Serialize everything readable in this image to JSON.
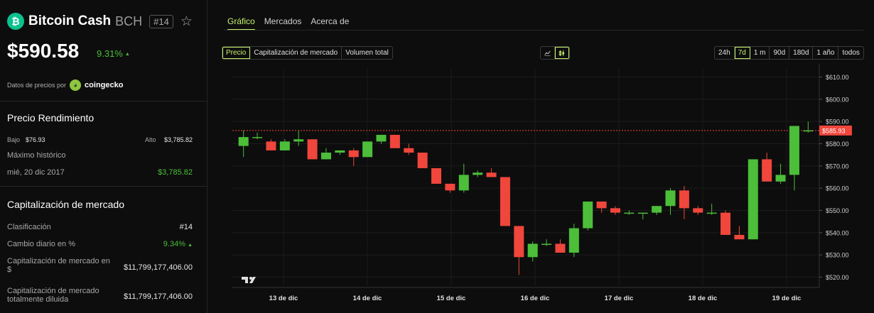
{
  "coin": {
    "logo_glyph": "₿",
    "name": "Bitcoin Cash",
    "symbol": "BCH",
    "rank_badge": "#14",
    "price": "$590.58",
    "change": "9.31%",
    "change_arrow": "▲",
    "data_by_label": "Datos de precios por",
    "data_provider": "coingecko"
  },
  "performance": {
    "title": "Precio Rendimiento",
    "low_label": "Bajo",
    "low_value": "$76.93",
    "high_label": "Alto",
    "high_value": "$3,785.82",
    "ath_label": "Máximo histórico",
    "ath_date": "mié, 20 dic 2017",
    "ath_value": "$3,785.82"
  },
  "market_cap": {
    "title": "Capitalización de mercado",
    "rows": [
      {
        "label": "Clasificación",
        "value": "#14"
      },
      {
        "label": "Cambio diario en %",
        "value": "9.34%",
        "arrow": "▲"
      },
      {
        "label": "Capitalización de mercado en",
        "label2": "$",
        "value": "$11,799,177,406.00"
      },
      {
        "label": "Capitalización de mercado",
        "label2": "totalmente diluida",
        "value": "$11,799,177,406.00"
      }
    ]
  },
  "tabs": [
    "Gráfico",
    "Mercados",
    "Acerca de"
  ],
  "metric_buttons": [
    "Precio",
    "Capitalización de mercado",
    "Volumen total"
  ],
  "range_buttons": [
    "24h",
    "7d",
    "1 m",
    "90d",
    "180d",
    "1 año",
    "todos"
  ],
  "icons": {
    "line_chart": "line-chart-icon",
    "candles": "candlestick-icon",
    "tv": "tradingview-logo-icon"
  },
  "colors": {
    "accent": "#c6f16b",
    "up": "#4cbe3a",
    "down": "#f0463c",
    "bg": "#0d0d0d"
  },
  "chart_data": {
    "type": "candlestick",
    "x_labels": [
      "13 de dic",
      "14 de dic",
      "15 de dic",
      "16 de dic",
      "17 de dic",
      "18 de dic",
      "19 de dic"
    ],
    "y_ticks": [
      "$520.00",
      "$530.00",
      "$540.00",
      "$550.00",
      "$560.00",
      "$570.00",
      "$580.00",
      "$590.00",
      "$600.00",
      "$610.00"
    ],
    "ylim": [
      516,
      614
    ],
    "current_price_label": "$585.93",
    "current_price": 585.93,
    "candles": [
      {
        "o": 579,
        "h": 586,
        "l": 574,
        "c": 583
      },
      {
        "o": 583,
        "h": 585,
        "l": 582,
        "c": 583
      },
      {
        "o": 581,
        "h": 582,
        "l": 577,
        "c": 577
      },
      {
        "o": 577,
        "h": 582,
        "l": 577,
        "c": 581
      },
      {
        "o": 581,
        "h": 586,
        "l": 579,
        "c": 582
      },
      {
        "o": 582,
        "h": 582,
        "l": 573,
        "c": 573
      },
      {
        "o": 573,
        "h": 578,
        "l": 573,
        "c": 576
      },
      {
        "o": 576,
        "h": 577,
        "l": 575,
        "c": 577
      },
      {
        "o": 577,
        "h": 578,
        "l": 570,
        "c": 574
      },
      {
        "o": 574,
        "h": 581,
        "l": 574,
        "c": 581
      },
      {
        "o": 581,
        "h": 584,
        "l": 580,
        "c": 584
      },
      {
        "o": 584,
        "h": 584,
        "l": 578,
        "c": 578
      },
      {
        "o": 578,
        "h": 580,
        "l": 575,
        "c": 576
      },
      {
        "o": 576,
        "h": 576,
        "l": 569,
        "c": 569
      },
      {
        "o": 569,
        "h": 569,
        "l": 562,
        "c": 562
      },
      {
        "o": 562,
        "h": 562,
        "l": 558,
        "c": 559
      },
      {
        "o": 559,
        "h": 571,
        "l": 558,
        "c": 566
      },
      {
        "o": 566,
        "h": 568,
        "l": 565,
        "c": 567
      },
      {
        "o": 567,
        "h": 569,
        "l": 565,
        "c": 565
      },
      {
        "o": 565,
        "h": 565,
        "l": 543,
        "c": 543
      },
      {
        "o": 543,
        "h": 543,
        "l": 521,
        "c": 529
      },
      {
        "o": 529,
        "h": 536,
        "l": 527,
        "c": 535
      },
      {
        "o": 535,
        "h": 537,
        "l": 534,
        "c": 535
      },
      {
        "o": 535,
        "h": 537,
        "l": 531,
        "c": 531
      },
      {
        "o": 531,
        "h": 544,
        "l": 529,
        "c": 542
      },
      {
        "o": 542,
        "h": 554,
        "l": 541,
        "c": 554
      },
      {
        "o": 554,
        "h": 554,
        "l": 549,
        "c": 551
      },
      {
        "o": 551,
        "h": 552,
        "l": 548,
        "c": 549
      },
      {
        "o": 549,
        "h": 550,
        "l": 548,
        "c": 549
      },
      {
        "o": 549,
        "h": 549,
        "l": 546,
        "c": 549
      },
      {
        "o": 549,
        "h": 552,
        "l": 548,
        "c": 552
      },
      {
        "o": 552,
        "h": 560,
        "l": 548,
        "c": 559
      },
      {
        "o": 559,
        "h": 561,
        "l": 546,
        "c": 551
      },
      {
        "o": 551,
        "h": 552,
        "l": 548,
        "c": 549
      },
      {
        "o": 549,
        "h": 553,
        "l": 548,
        "c": 549
      },
      {
        "o": 549,
        "h": 550,
        "l": 539,
        "c": 539
      },
      {
        "o": 539,
        "h": 543,
        "l": 537,
        "c": 537
      },
      {
        "o": 537,
        "h": 573,
        "l": 537,
        "c": 573
      },
      {
        "o": 573,
        "h": 576,
        "l": 563,
        "c": 563
      },
      {
        "o": 563,
        "h": 571,
        "l": 562,
        "c": 566
      },
      {
        "o": 566,
        "h": 588,
        "l": 559,
        "c": 588
      },
      {
        "o": 586,
        "h": 590,
        "l": 585,
        "c": 586
      }
    ]
  }
}
